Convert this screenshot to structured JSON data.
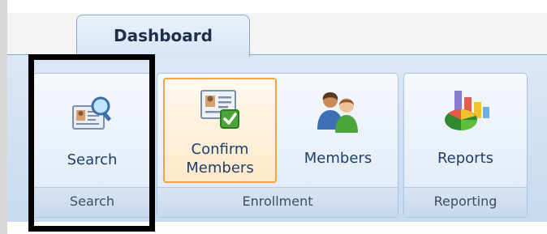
{
  "tab": {
    "label": "Dashboard"
  },
  "groups": {
    "search": {
      "label": "Search",
      "buttons": {
        "search": {
          "label": "Search",
          "icon": "search-icon"
        }
      }
    },
    "enrollment": {
      "label": "Enrollment",
      "buttons": {
        "confirm_members": {
          "label_line1": "Confirm",
          "label_line2": "Members",
          "icon": "id-card-check-icon",
          "selected": true
        },
        "members": {
          "label": "Members",
          "icon": "members-icon"
        }
      }
    },
    "reporting": {
      "label": "Reporting",
      "buttons": {
        "reports": {
          "label": "Reports",
          "icon": "pie-bar-chart-icon"
        }
      }
    }
  },
  "colors": {
    "ribbon": "#c7daf0",
    "selected_border": "#f0a348",
    "highlight_box": "#000000"
  }
}
